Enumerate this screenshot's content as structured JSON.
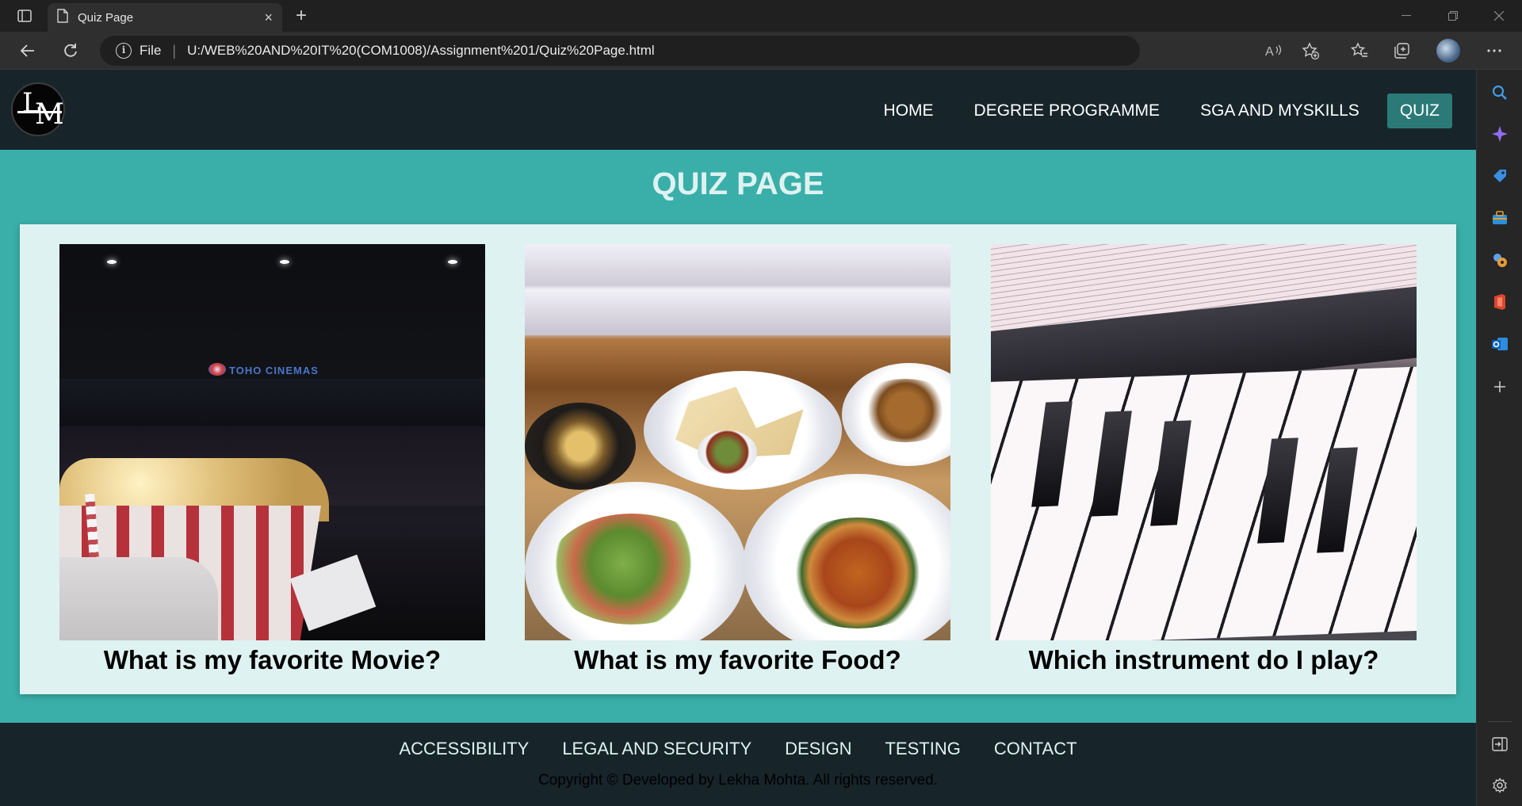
{
  "browser": {
    "tab_title": "Quiz Page",
    "new_tab_symbol": "+",
    "close_tab_symbol": "×",
    "address_scheme": "File",
    "url": "U:/WEB%20AND%20IT%20(COM1008)/Assignment%201/Quiz%20Page.html",
    "icons": {
      "back": "back-arrow-icon",
      "reload": "reload-icon",
      "info": "info-icon",
      "read_aloud": "read-aloud-icon",
      "add_favorite": "add-favorite-icon",
      "favorites": "favorites-icon",
      "collections": "collections-icon",
      "profile": "profile-icon",
      "more": "more-icon"
    },
    "sidebar_icons": [
      "search-icon",
      "copilot-icon",
      "shopping-icon",
      "tools-icon",
      "games-icon",
      "office-icon",
      "outlook-icon",
      "add-icon",
      "hide-sidebar-icon",
      "settings-icon"
    ]
  },
  "site": {
    "logo_text": "LM",
    "nav": [
      {
        "label": "HOME",
        "active": false
      },
      {
        "label": "DEGREE PROGRAMME",
        "active": false
      },
      {
        "label": "SGA AND MYSKILLS",
        "active": false
      },
      {
        "label": "QUIZ",
        "active": true
      }
    ],
    "page_title": "QUIZ PAGE",
    "quiz_cards": [
      {
        "question": "What is my favorite Movie?",
        "image": "cinema-popcorn-photo"
      },
      {
        "question": "What is my favorite Food?",
        "image": "food-plates-photo"
      },
      {
        "question": "Which instrument do I play?",
        "image": "piano-keys-photo"
      }
    ],
    "movie_image_sign": "TOHO CINEMAS",
    "footer_nav": [
      "ACCESSIBILITY",
      "LEGAL AND SECURITY",
      "DESIGN",
      "TESTING",
      "CONTACT"
    ],
    "copyright": "Copyright © Developed by Lekha Mohta. All rights reserved."
  },
  "colors": {
    "header_bg": "#17242a",
    "page_bg": "#3aafa9",
    "panel_bg": "#def2f1",
    "active_nav": "#2b7a78"
  }
}
